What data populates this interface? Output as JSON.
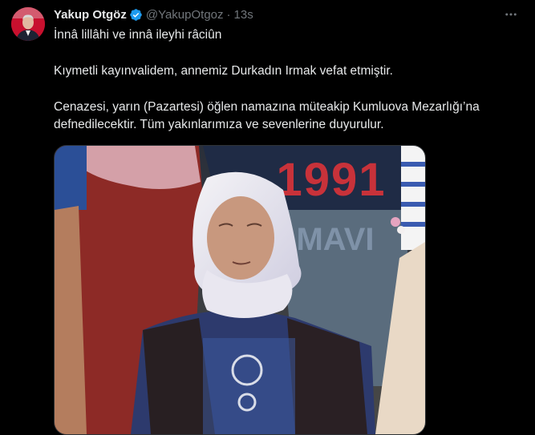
{
  "tweet": {
    "author_name": "Yakup Otgöz",
    "author_handle": "@YakupOtgoz",
    "separator": "·",
    "time": "13s",
    "paragraphs": [
      "İnnâ lillâhi ve innâ ileyhi râciûn",
      "Kıymetli kayınvalidem, annemiz Durkadın Irmak vefat etmiştir.",
      "Cenazesi, yarın (Pazartesi) öğlen namazına müteakip Kumluova Mezarlığı’na defnedilecektir. Tüm yakınlarımıza ve sevenlerine duyurulur."
    ],
    "photo_text": {
      "shirt_number": "1991",
      "shirt_brand": "MAVI"
    }
  },
  "colors": {
    "background": "#000000",
    "text": "#e7e9ea",
    "secondary": "#71767b",
    "verified": "#1d9bf0"
  },
  "icons": {
    "verified": "verified-badge-icon",
    "more": "more-horizontal-icon"
  }
}
